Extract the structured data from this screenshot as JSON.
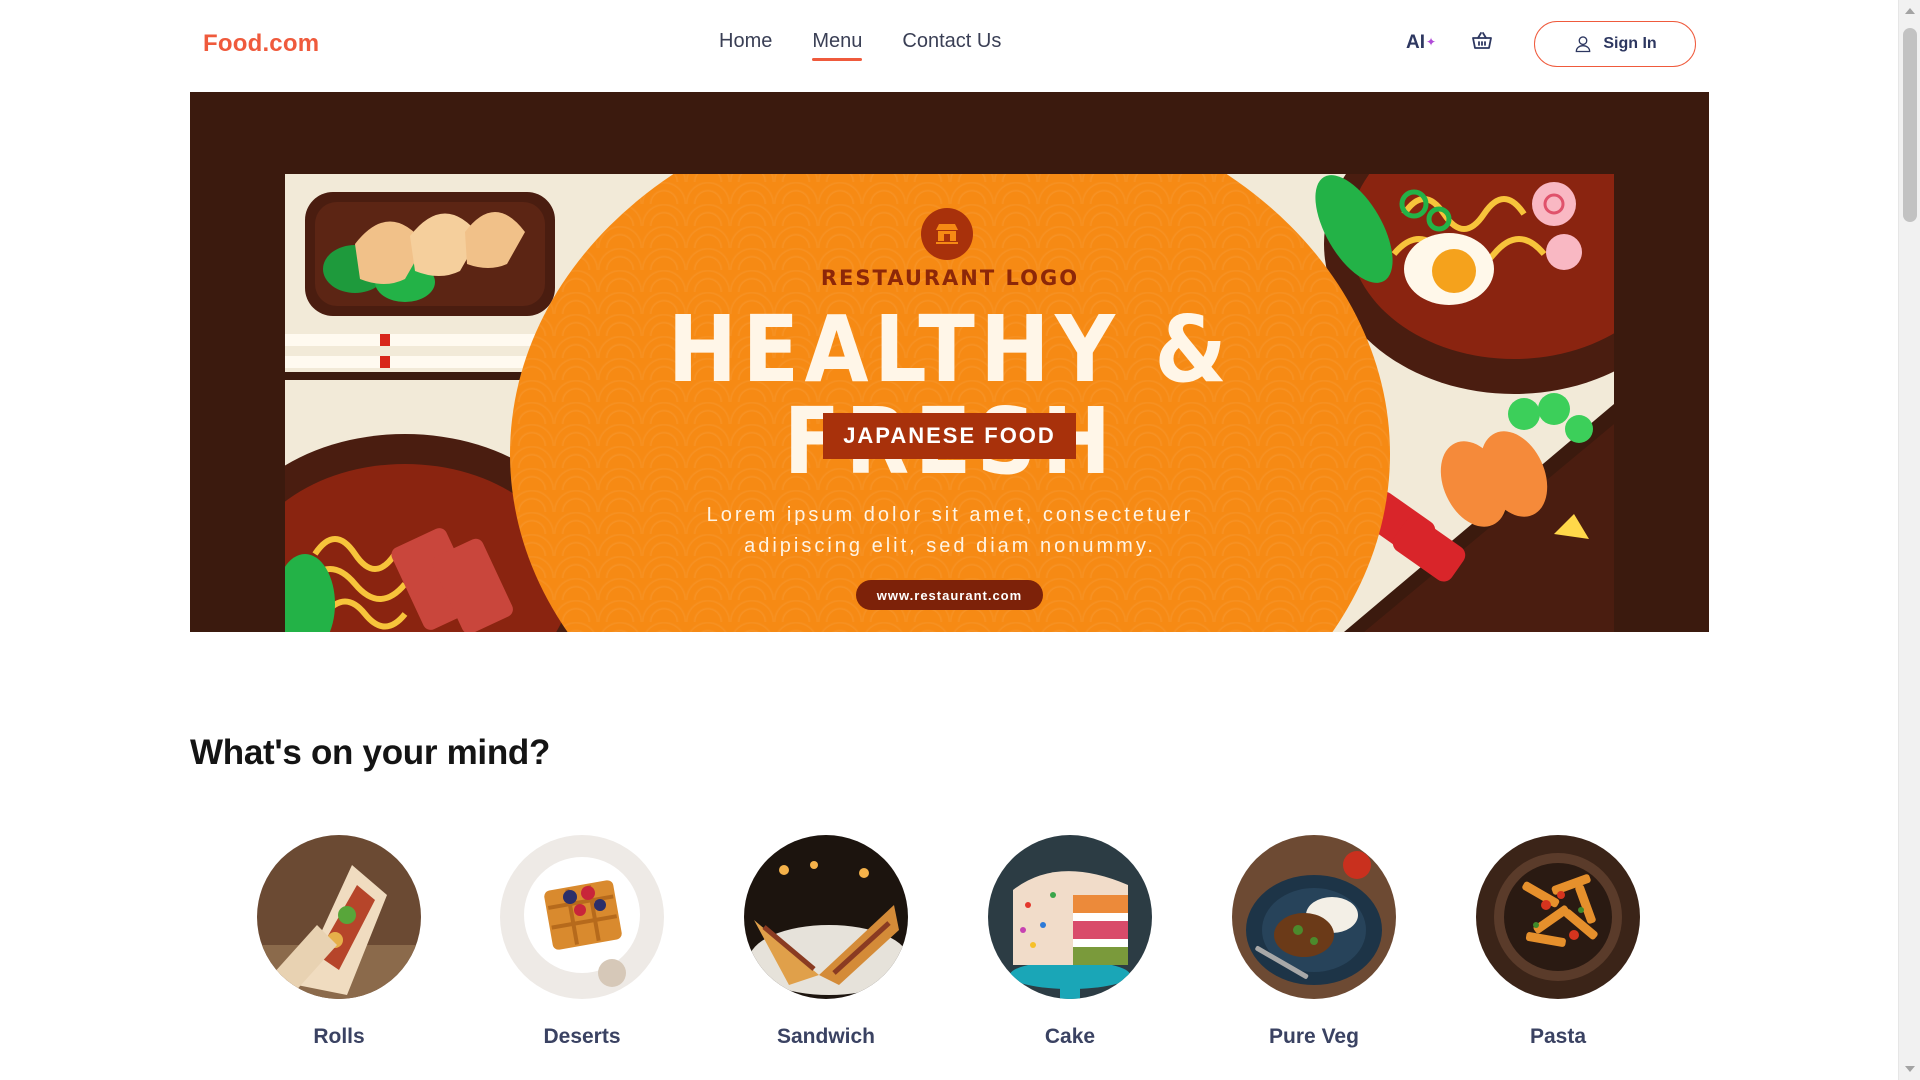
{
  "header": {
    "brand": "Food.com",
    "nav": [
      "Home",
      "Menu",
      "Contact Us"
    ],
    "active_nav": "Menu",
    "ai_label": "AI",
    "signin_label": "Sign In"
  },
  "banner": {
    "logo_text": "RESTAURANT LOGO",
    "headline": "HEALTHY & FRESH",
    "tag": "JAPANESE FOOD",
    "lorem_line1": "Lorem ipsum dolor sit amet, consectetuer",
    "lorem_line2": "adipiscing elit, sed diam nonummy.",
    "url": "www.restaurant.com"
  },
  "section": {
    "title": "What's on your mind?"
  },
  "categories": [
    {
      "label": "Rolls"
    },
    {
      "label": "Deserts"
    },
    {
      "label": "Sandwich"
    },
    {
      "label": "Cake"
    },
    {
      "label": "Pure Veg"
    },
    {
      "label": "Pasta"
    }
  ],
  "colors": {
    "accent": "#ef5a3c",
    "nav_text": "#3a3f55",
    "banner_bg": "#3b1a0e",
    "banner_orange": "#f68a14",
    "banner_red": "#a8310b"
  },
  "icons": {
    "ai": "sparkle-icon",
    "cart": "basket-icon",
    "signin": "user-icon",
    "logo": "restaurant-icon"
  }
}
